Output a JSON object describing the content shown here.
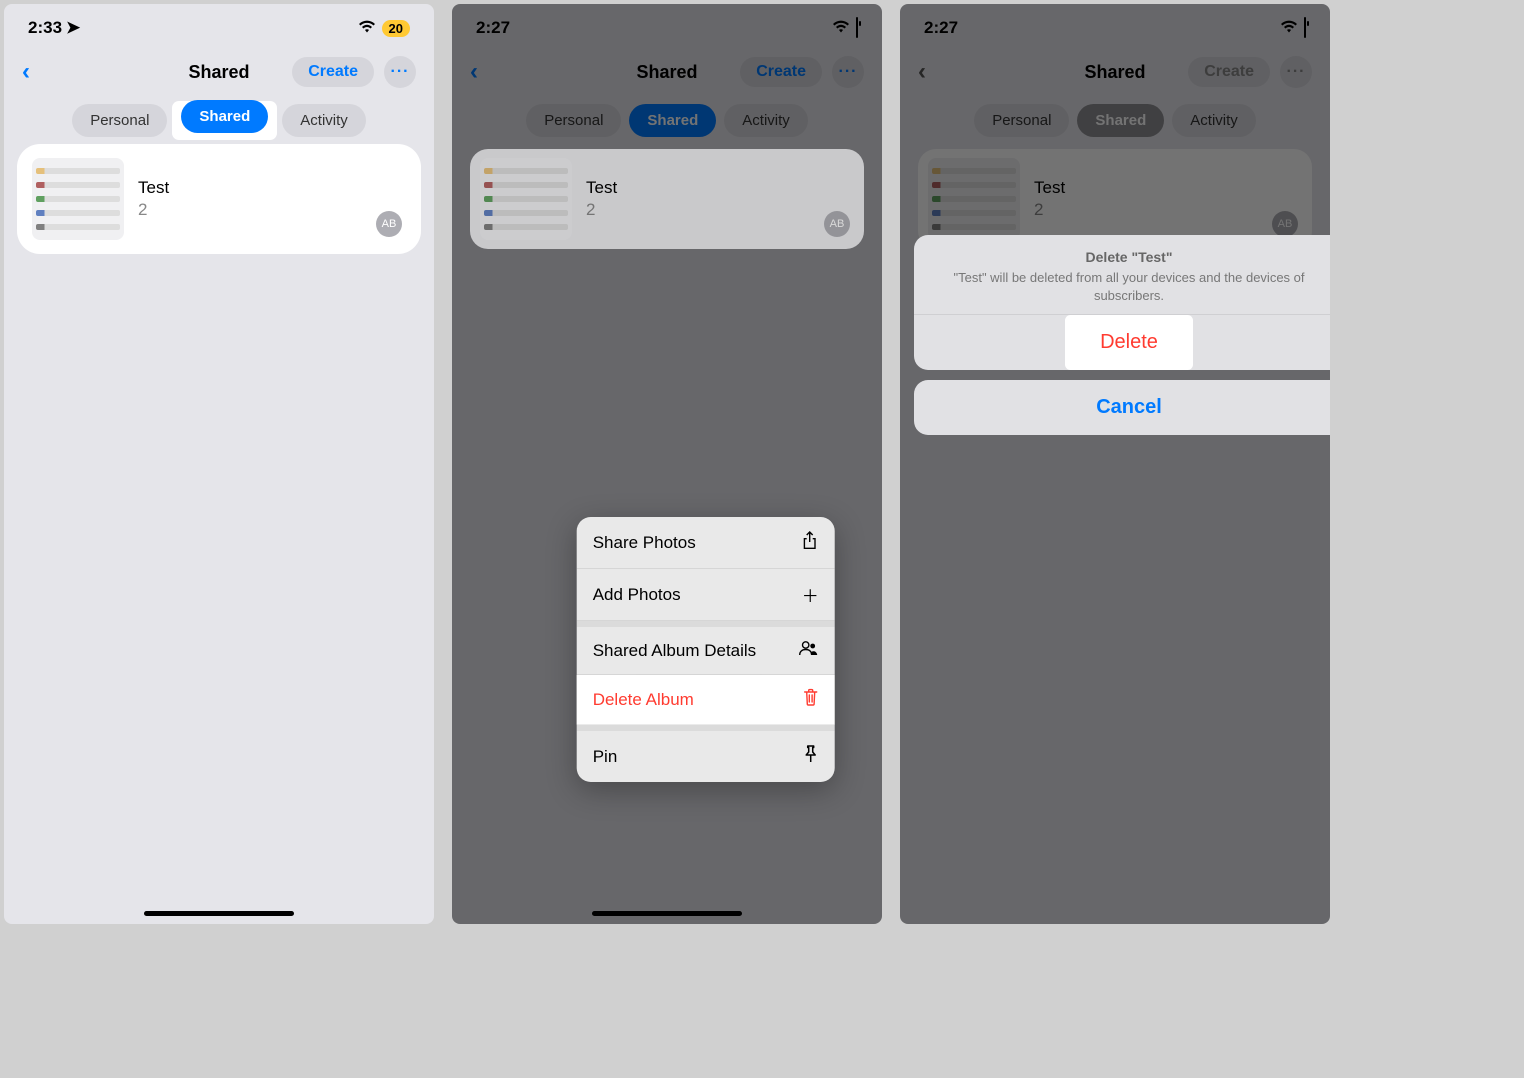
{
  "screen1": {
    "status": {
      "time": "2:33",
      "location_arrow": "➤",
      "signal": "􀙇",
      "battery_badge": "20"
    },
    "nav": {
      "title": "Shared",
      "create": "Create"
    },
    "tabs": {
      "personal": "Personal",
      "shared": "Shared",
      "activity": "Activity"
    },
    "album": {
      "title": "Test",
      "count": "2",
      "avatar": "AB"
    }
  },
  "screen2": {
    "status": {
      "time": "2:27"
    },
    "nav": {
      "title": "Shared",
      "create": "Create"
    },
    "tabs": {
      "personal": "Personal",
      "shared": "Shared",
      "activity": "Activity"
    },
    "album": {
      "title": "Test",
      "count": "2",
      "avatar": "AB"
    },
    "menu": {
      "share_photos": "Share Photos",
      "add_photos": "Add Photos",
      "details": "Shared Album Details",
      "delete_album": "Delete Album",
      "pin": "Pin"
    }
  },
  "screen3": {
    "status": {
      "time": "2:27"
    },
    "nav": {
      "title": "Shared",
      "create": "Create"
    },
    "tabs": {
      "personal": "Personal",
      "shared": "Shared",
      "activity": "Activity"
    },
    "album": {
      "title": "Test",
      "count": "2",
      "avatar": "AB"
    },
    "sheet": {
      "title": "Delete \"Test\"",
      "message": "\"Test\" will be deleted from all your devices and the devices of subscribers.",
      "delete": "Delete",
      "cancel": "Cancel"
    }
  }
}
